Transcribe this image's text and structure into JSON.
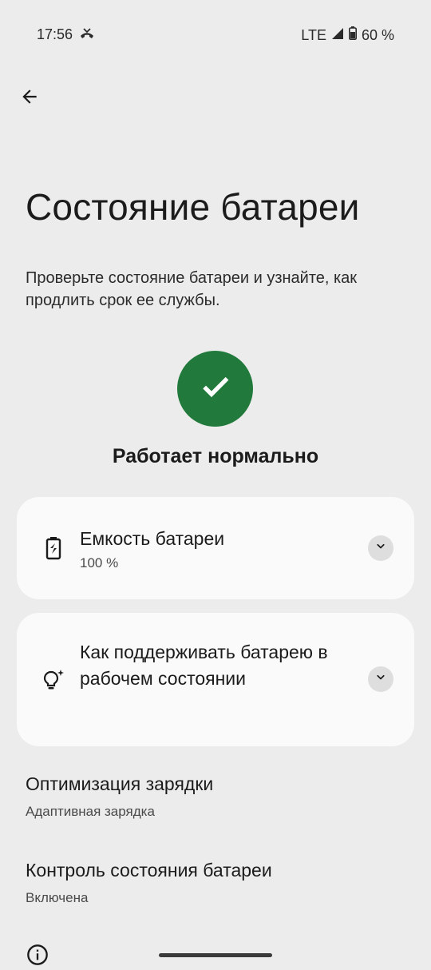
{
  "status_bar": {
    "time": "17:56",
    "network": "LTE",
    "battery": "60 %",
    "icons": [
      "missed-call-icon",
      "signal-icon",
      "battery-icon"
    ]
  },
  "page": {
    "title": "Состояние батареи",
    "description": "Проверьте состояние батареи и узнайте, как продлить срок ее службы."
  },
  "status": {
    "label": "Работает нормально",
    "color": "#217a3b",
    "icon": "check-icon"
  },
  "cards": [
    {
      "title": "Емкость батареи",
      "subtitle": "100 %",
      "icon": "battery-swap-icon"
    },
    {
      "title": "Как поддерживать батарею в рабочем состоянии",
      "icon": "lightbulb-sparkle-icon"
    }
  ],
  "settings": [
    {
      "title": "Оптимизация зарядки",
      "subtitle": "Адаптивная зарядка"
    },
    {
      "title": "Контроль состояния батареи",
      "subtitle": "Включена"
    }
  ]
}
